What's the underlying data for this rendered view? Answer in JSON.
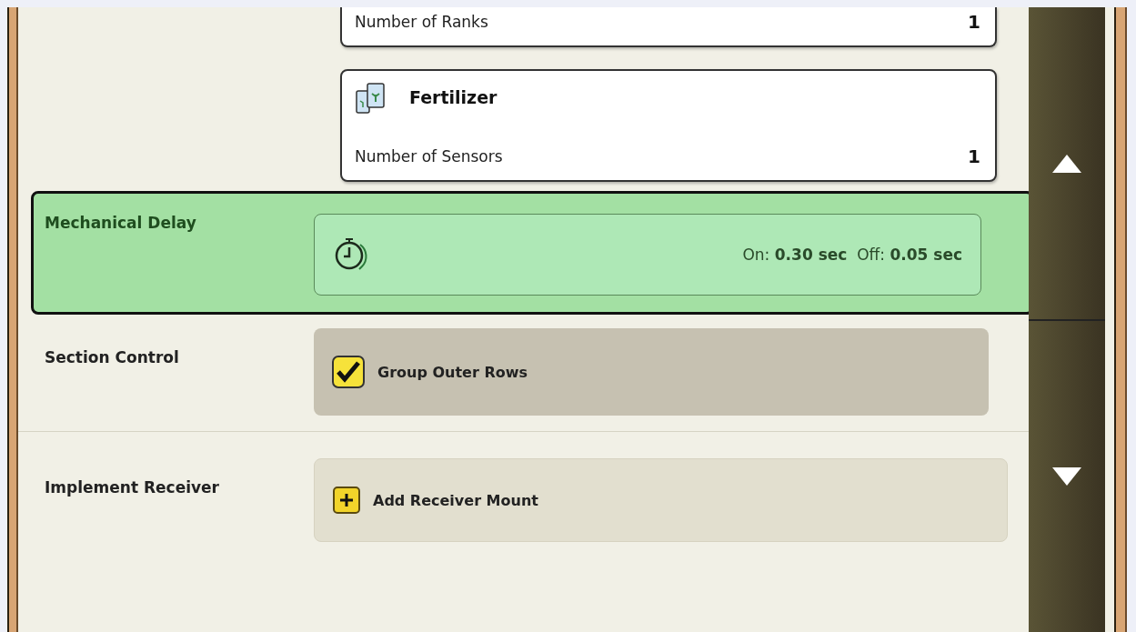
{
  "cards": [
    {
      "kind": "row",
      "label": "Number of Ranks",
      "value": "1"
    },
    {
      "kind": "product",
      "title": "Fertilizer",
      "label": "Number of Sensors",
      "value": "1"
    }
  ],
  "rows": [
    {
      "kind": "delay",
      "label": "Mechanical Delay",
      "selected": true,
      "on_label": "On:",
      "on_value": "0.30 sec",
      "off_label": "Off:",
      "off_value": "0.05 sec"
    },
    {
      "kind": "checkbox",
      "label": "Section Control",
      "text": "Group Outer Rows",
      "checked": true
    },
    {
      "kind": "add",
      "label": "Implement Receiver",
      "text": "Add Receiver Mount"
    }
  ]
}
